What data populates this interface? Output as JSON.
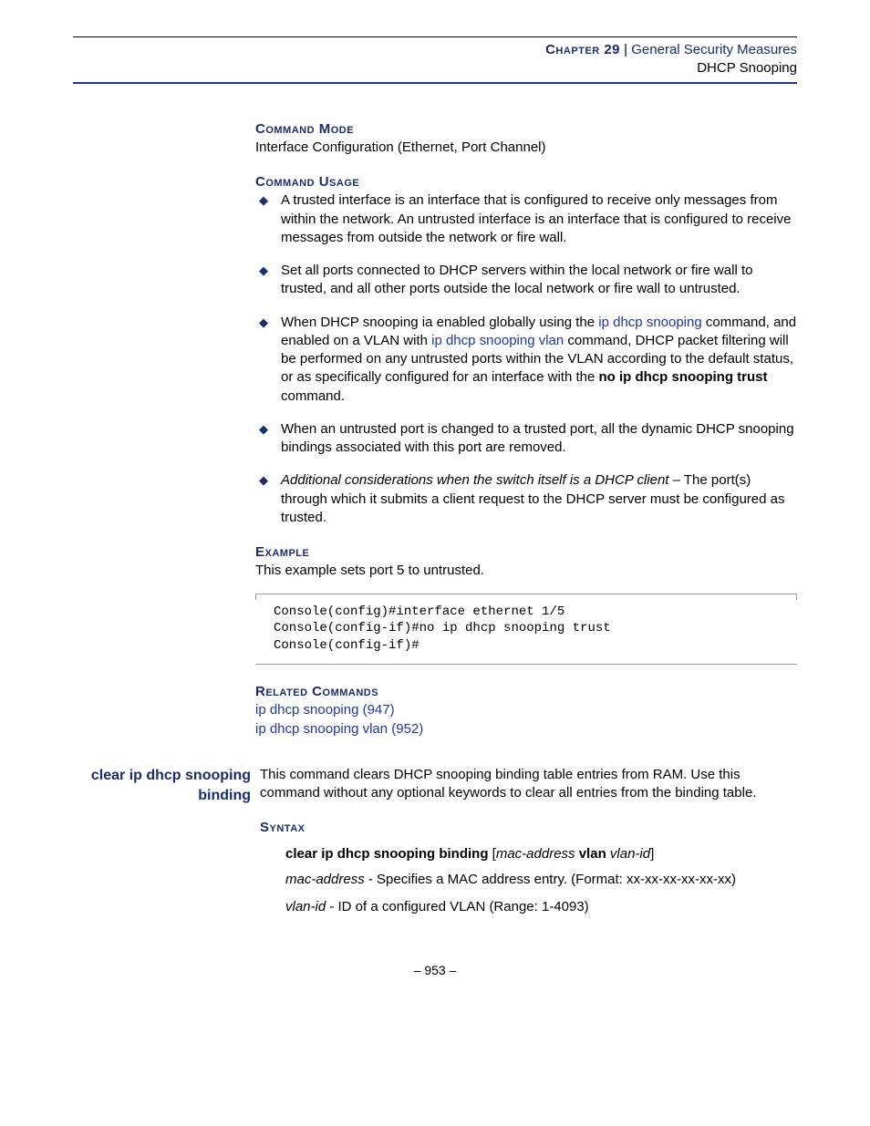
{
  "header": {
    "chapter_label": "Chapter 29",
    "separator": "  |  ",
    "chapter_title": "General Security Measures",
    "section_title": "DHCP Snooping"
  },
  "cmd_mode": {
    "heading": "Command Mode",
    "text": "Interface Configuration (Ethernet, Port Channel)"
  },
  "cmd_usage": {
    "heading": "Command Usage",
    "b1": "A trusted interface is an interface that is configured to receive only messages from within the network. An untrusted interface is an interface that is configured to receive messages from outside the network or fire wall.",
    "b2": "Set all ports connected to DHCP servers within the local network or fire wall to trusted, and all other ports outside the local network or fire wall to untrusted.",
    "b3_p1": "When DHCP snooping ia enabled globally using the ",
    "b3_link1": "ip dhcp snooping",
    "b3_p2": " command, and enabled on a VLAN with ",
    "b3_link2": "ip dhcp snooping vlan",
    "b3_p3": " command, DHCP packet filtering will be performed on any untrusted ports within the VLAN according to the default status, or as specifically configured for an interface with the ",
    "b3_bold": "no ip dhcp snooping trust",
    "b3_p4": " command.",
    "b4": "When an untrusted port is changed to a trusted port, all the dynamic DHCP snooping bindings associated with this port are removed.",
    "b5_em": "Additional considerations when the switch itself is a DHCP client",
    "b5_rest": " – The port(s) through which it submits a client request to the DHCP server must be configured as trusted."
  },
  "example": {
    "heading": "Example",
    "text": "This example sets port 5 to untrusted.",
    "code": "Console(config)#interface ethernet 1/5\nConsole(config-if)#no ip dhcp snooping trust\nConsole(config-if)#"
  },
  "related": {
    "heading": "Related Commands",
    "l1": "ip dhcp snooping (947)",
    "l2": "ip dhcp snooping vlan (952)"
  },
  "cmd2": {
    "sidebar": "clear ip dhcp snooping binding",
    "desc": "This command clears DHCP snooping binding table entries from RAM. Use this command without any optional keywords to clear all entries from the binding table.",
    "syntax_heading": "Syntax",
    "syntax_bold": "clear ip dhcp snooping binding",
    "syntax_br1": " [",
    "syntax_it1": "mac-address",
    "syntax_sp": " ",
    "syntax_bold2": "vlan",
    "syntax_it2": " vlan-id",
    "syntax_br2": "]",
    "p1_it": "mac-address",
    "p1_rest": " - Specifies a MAC address entry. (Format: xx-xx-xx-xx-xx-xx)",
    "p2_it": "vlan-id",
    "p2_rest": " - ID of a configured VLAN (Range: 1-4093)"
  },
  "footer": {
    "page": "–  953  –"
  }
}
